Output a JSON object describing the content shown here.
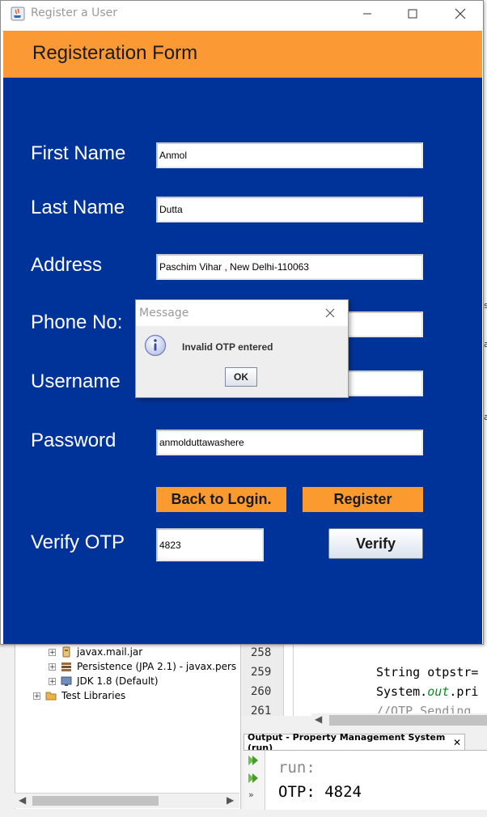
{
  "window": {
    "title": "Register a User",
    "header": "Registeration Form"
  },
  "form": {
    "first_name_label": "First Name",
    "first_name_value": "Anmol",
    "last_name_label": "Last Name",
    "last_name_value": "Dutta",
    "address_label": "Address",
    "address_value": "Paschim Vihar , New Delhi-110063",
    "phone_label": "Phone No:",
    "phone_value": "",
    "username_label": "Username",
    "username_value": "",
    "password_label": "Password",
    "password_value": "anmolduttawashere",
    "back_button": "Back to Login.",
    "register_button": "Register",
    "otp_label": "Verify OTP",
    "otp_value": "4823",
    "verify_button": "Verify"
  },
  "dialog": {
    "title": "Message",
    "message": "Invalid OTP entered",
    "ok_button": "OK"
  },
  "ide": {
    "tree_items": [
      "javax.mail.jar",
      "Persistence (JPA 2.1) - javax.pers",
      "JDK 1.8 (Default)",
      "Test Libraries"
    ],
    "line_numbers": [
      "258",
      "259",
      "260",
      "261"
    ],
    "code": {
      "line_259": "String otpstr=",
      "line_260_a": "System.",
      "line_260_b": "out",
      "line_260_c": ".pri",
      "line_261": "//OTP Sending"
    },
    "output_tab": "Output - Property Management System (run)",
    "output_lines": [
      "run:",
      "OTP: 4824"
    ],
    "right_edge_chars": [
      "a",
      "a",
      "s"
    ]
  },
  "colors": {
    "form_background": "#003399",
    "header_orange": "#fb9a35",
    "button_orange": "#fb9a2f"
  }
}
